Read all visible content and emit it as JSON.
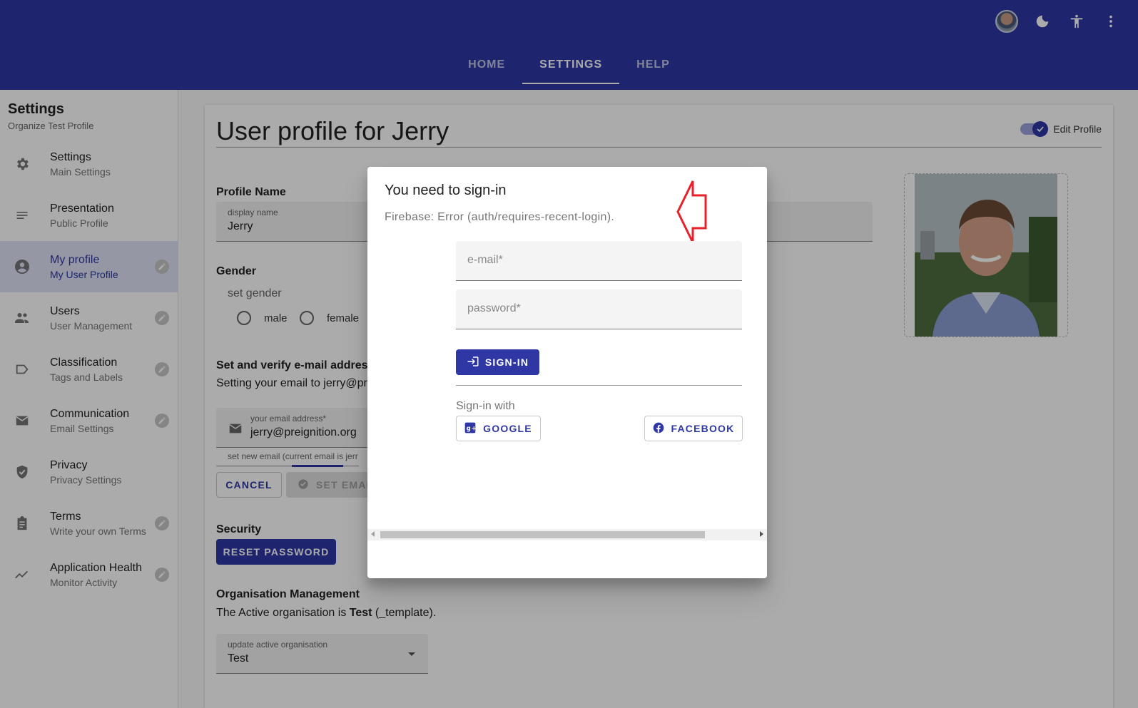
{
  "appbar": {
    "tabs": [
      {
        "label": "HOME",
        "active": false
      },
      {
        "label": "SETTINGS",
        "active": true
      },
      {
        "label": "HELP",
        "active": false
      }
    ],
    "actions": [
      "avatar",
      "moon-icon",
      "accessibility-icon",
      "more-vert-icon"
    ]
  },
  "sidebar": {
    "title": "Settings",
    "subtitle": "Organize Test Profile",
    "items": [
      {
        "label": "Settings",
        "sub": "Main Settings",
        "icon": "gear-icon",
        "badge": false
      },
      {
        "label": "Presentation",
        "sub": "Public Profile",
        "icon": "notes-icon",
        "badge": false
      },
      {
        "label": "My profile",
        "sub": "My User Profile",
        "icon": "account-circle-icon",
        "badge": true,
        "active": true
      },
      {
        "label": "Users",
        "sub": "User Management",
        "icon": "people-icon",
        "badge": true
      },
      {
        "label": "Classification",
        "sub": "Tags and Labels",
        "icon": "label-icon",
        "badge": true
      },
      {
        "label": "Communication",
        "sub": "Email Settings",
        "icon": "mail-icon",
        "badge": true
      },
      {
        "label": "Privacy",
        "sub": "Privacy Settings",
        "icon": "shield-icon",
        "badge": false
      },
      {
        "label": "Terms",
        "sub": "Write your own Terms",
        "icon": "clipboard-icon",
        "badge": true
      },
      {
        "label": "Application Health",
        "sub": "Monitor Activity",
        "icon": "trending-icon",
        "badge": true
      }
    ]
  },
  "profile": {
    "title": "User profile for Jerry",
    "edit_toggle_label": "Edit Profile",
    "edit_enabled": true,
    "profile_name_label": "Profile Name",
    "display_name_label": "display name",
    "display_name_value": "Jerry",
    "gender_label": "Gender",
    "gender_hint": "set gender",
    "gender_options": [
      "male",
      "female"
    ],
    "email_section_label": "Set and verify e-mail address",
    "email_setting_text": "Setting your email to jerry@pre",
    "email_field_label": "your email address*",
    "email_field_value": "jerry@preignition.org",
    "email_helper": "set new email (current email is jerr",
    "cancel_label": "CANCEL",
    "set_email_label": "SET EMAI",
    "security_label": "Security",
    "reset_password_label": "RESET PASSWORD",
    "org_label": "Organisation Management",
    "org_text_prefix": "The Active organisation is ",
    "org_text_bold": "Test",
    "org_text_suffix": " (_template).",
    "org_select_label": "update active organisation",
    "org_select_value": "Test"
  },
  "dialog": {
    "title": "You need to sign-in",
    "error": "Firebase: Error (auth/requires-recent-login).",
    "email_placeholder": "e-mail*",
    "password_placeholder": "password*",
    "signin_label": "SIGN-IN",
    "sign_in_with": "Sign-in with",
    "google_label": "GOOGLE",
    "facebook_label": "FACEBOOK",
    "annotation_color": "#e8202a"
  },
  "colors": {
    "primary": "#2e37a3",
    "active_nav_bg": "#dfe2f7"
  }
}
